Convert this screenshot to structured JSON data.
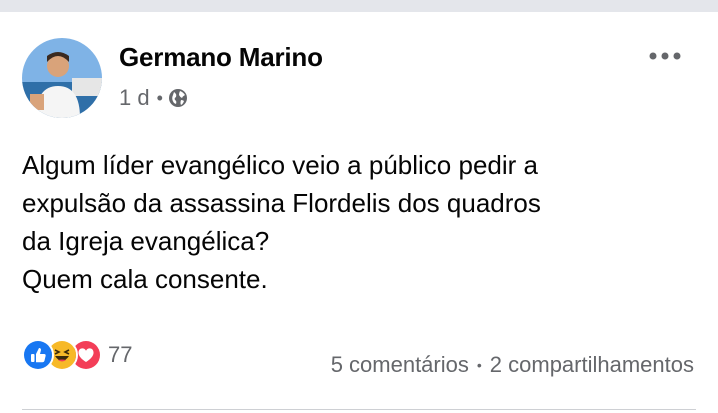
{
  "post": {
    "author": "Germano Marino",
    "time": "1 d",
    "meta_separator": "•",
    "privacy_icon": "globe-icon",
    "options_icon": "more-options-icon",
    "text": "Algum líder evangélico veio a público pedir a\nexpulsão da assassina Flordelis dos quadros\nda Igreja evangélica?\nQuem cala consente."
  },
  "reactions": {
    "icons": [
      "like-icon",
      "haha-icon",
      "love-icon"
    ],
    "count": "77"
  },
  "stats": {
    "comments": "5 comentários",
    "separator": "•",
    "shares": "2 compartilhamentos"
  },
  "colors": {
    "like": "#1877f2",
    "haha": "#f7b928",
    "love": "#f33e58",
    "secondary_text": "#65676b",
    "primary_text": "#050505"
  }
}
